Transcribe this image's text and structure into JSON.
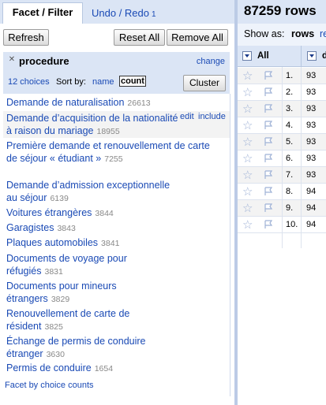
{
  "tabs": {
    "facet_filter": "Facet / Filter",
    "undo_redo": "Undo / Redo",
    "undo_count": "1"
  },
  "toolbar": {
    "refresh": "Refresh",
    "reset_all": "Reset All",
    "remove_all": "Remove All"
  },
  "facet": {
    "close_icon": "close-x-icon",
    "name": "procedure",
    "change": "change",
    "choices": "12 choices",
    "sort_by": "Sort by:",
    "sort_name": "name",
    "sort_count": "count",
    "cluster": "Cluster",
    "edit": "edit",
    "include": "include",
    "items": [
      {
        "label": "Demande de naturalisation",
        "count": "26613"
      },
      {
        "label": "Demande d’acquisition de la nationalité à raison du mariage",
        "count": "18955"
      },
      {
        "label": "Première demande et renouvellement de carte de séjour « étudiant »",
        "count": "7255"
      },
      {
        "label": "Demande d’admission exceptionnelle au séjour",
        "count": "6139"
      },
      {
        "label": "Voitures étrangères",
        "count": "3844"
      },
      {
        "label": "Garagistes",
        "count": "3843"
      },
      {
        "label": "Plaques automobiles",
        "count": "3841"
      },
      {
        "label": "Documents de voyage pour réfugiés",
        "count": "3831"
      },
      {
        "label": "Documents pour mineurs étrangers",
        "count": "3829"
      },
      {
        "label": "Renouvellement de carte de résident",
        "count": "3825"
      },
      {
        "label": "Échange de permis de conduire étranger",
        "count": "3630"
      },
      {
        "label": "Permis de conduire",
        "count": "1654"
      }
    ],
    "facet_by_counts": "Facet by choice counts"
  },
  "grid": {
    "rows_count": "87259 rows",
    "show_as": "Show as:",
    "rows_mode": "rows",
    "records_mode_partial": "re",
    "all_label": "All",
    "col_partial": "d",
    "rows": [
      {
        "n": "1.",
        "v": "93"
      },
      {
        "n": "2.",
        "v": "93"
      },
      {
        "n": "3.",
        "v": "93"
      },
      {
        "n": "4.",
        "v": "93"
      },
      {
        "n": "5.",
        "v": "93"
      },
      {
        "n": "6.",
        "v": "93"
      },
      {
        "n": "7.",
        "v": "93"
      },
      {
        "n": "8.",
        "v": "94"
      },
      {
        "n": "9.",
        "v": "94"
      },
      {
        "n": "10.",
        "v": "94"
      }
    ]
  }
}
